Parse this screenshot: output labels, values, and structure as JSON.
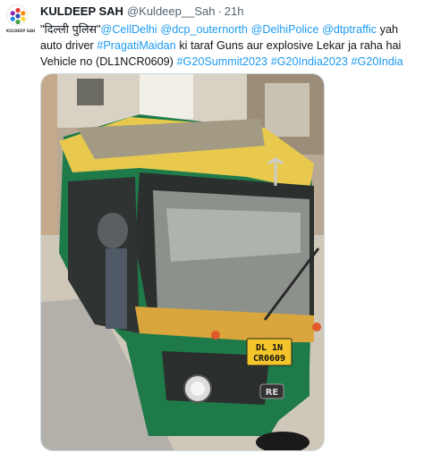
{
  "author": {
    "name": "KULDEEP SAH",
    "handle": "@Kuldeep__Sah",
    "separator": "·",
    "time": "21h",
    "avatar_caption": "KULDEEP SAH"
  },
  "tweet": {
    "line1": {
      "quote_text": "\"दिल्ली पुलिस\"",
      "mentions": "@CellDelhi @dcp_outernorth @DelhiPolice @dtptraffic",
      "tail": " yah"
    },
    "line2": {
      "lead": "auto driver ",
      "hashtag": "#PragatiMaidan",
      "tail": " ki taraf Guns aur explosive Lekar ja raha hai"
    },
    "line3": {
      "lead": "Vehicle no (DL1NCR0609) ",
      "hashtags": "#G20Summit2023 #G20India2023 #G20India"
    }
  },
  "media": {
    "plate_line1": "DL 1N",
    "plate_line2": "CR0609",
    "grille_badge": "RE"
  },
  "colors": {
    "link": "#1d9bf0",
    "text": "#0f1419",
    "muted": "#536471",
    "auto_yellow": "#e8c94e",
    "auto_green": "#1f7a4a"
  }
}
